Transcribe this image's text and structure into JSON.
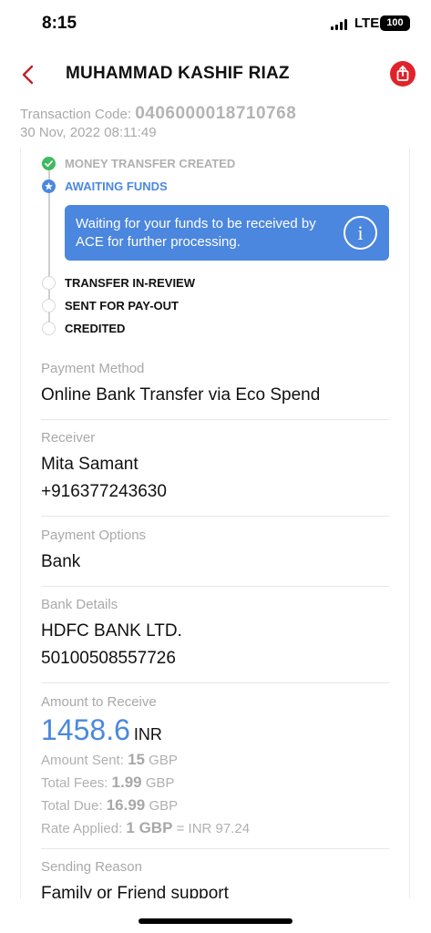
{
  "status_bar": {
    "time": "8:15",
    "network": "LTE",
    "battery": "100"
  },
  "header": {
    "title": "MUHAMMAD KASHIF RIAZ",
    "back_icon": "chevron-left-icon",
    "share_icon": "share-icon"
  },
  "transaction": {
    "code_label": "Transaction Code:",
    "code": "0406000018710768",
    "date": "30 Nov, 2022 08:11:49"
  },
  "timeline": {
    "steps": [
      {
        "label": "MONEY TRANSFER CREATED",
        "state": "done"
      },
      {
        "label": "AWAITING FUNDS",
        "state": "current"
      },
      {
        "label": "TRANSFER IN-REVIEW",
        "state": "pending"
      },
      {
        "label": "SENT FOR PAY-OUT",
        "state": "pending"
      },
      {
        "label": "CREDITED",
        "state": "pending"
      }
    ],
    "info_message": "Waiting for your funds to be received by ACE for further processing.",
    "info_icon": "info-icon"
  },
  "details": {
    "payment_method": {
      "label": "Payment Method",
      "value": "Online Bank Transfer via Eco Spend"
    },
    "receiver": {
      "label": "Receiver",
      "name": "Mita Samant",
      "phone": "+916377243630"
    },
    "payment_options": {
      "label": "Payment Options",
      "value": "Bank"
    },
    "bank_details": {
      "label": "Bank Details",
      "bank": "HDFC BANK LTD.",
      "account": "50100508557726"
    },
    "amount": {
      "label": "Amount to Receive",
      "value": "1458.6",
      "currency": "INR",
      "sent_label": "Amount Sent:",
      "sent_value": "15",
      "sent_currency": "GBP",
      "fees_label": "Total Fees:",
      "fees_value": "1.99",
      "fees_currency": "GBP",
      "due_label": "Total Due:",
      "due_value": "16.99",
      "due_currency": "GBP",
      "rate_label": "Rate Applied:",
      "rate_value": "1 GBP",
      "rate_result": "= INR 97.24"
    },
    "sending_reason": {
      "label": "Sending Reason",
      "value": "Family or Friend support"
    }
  },
  "colors": {
    "accent_red": "#e0232a",
    "accent_blue": "#4a88df",
    "success_green": "#3dbb5e"
  }
}
